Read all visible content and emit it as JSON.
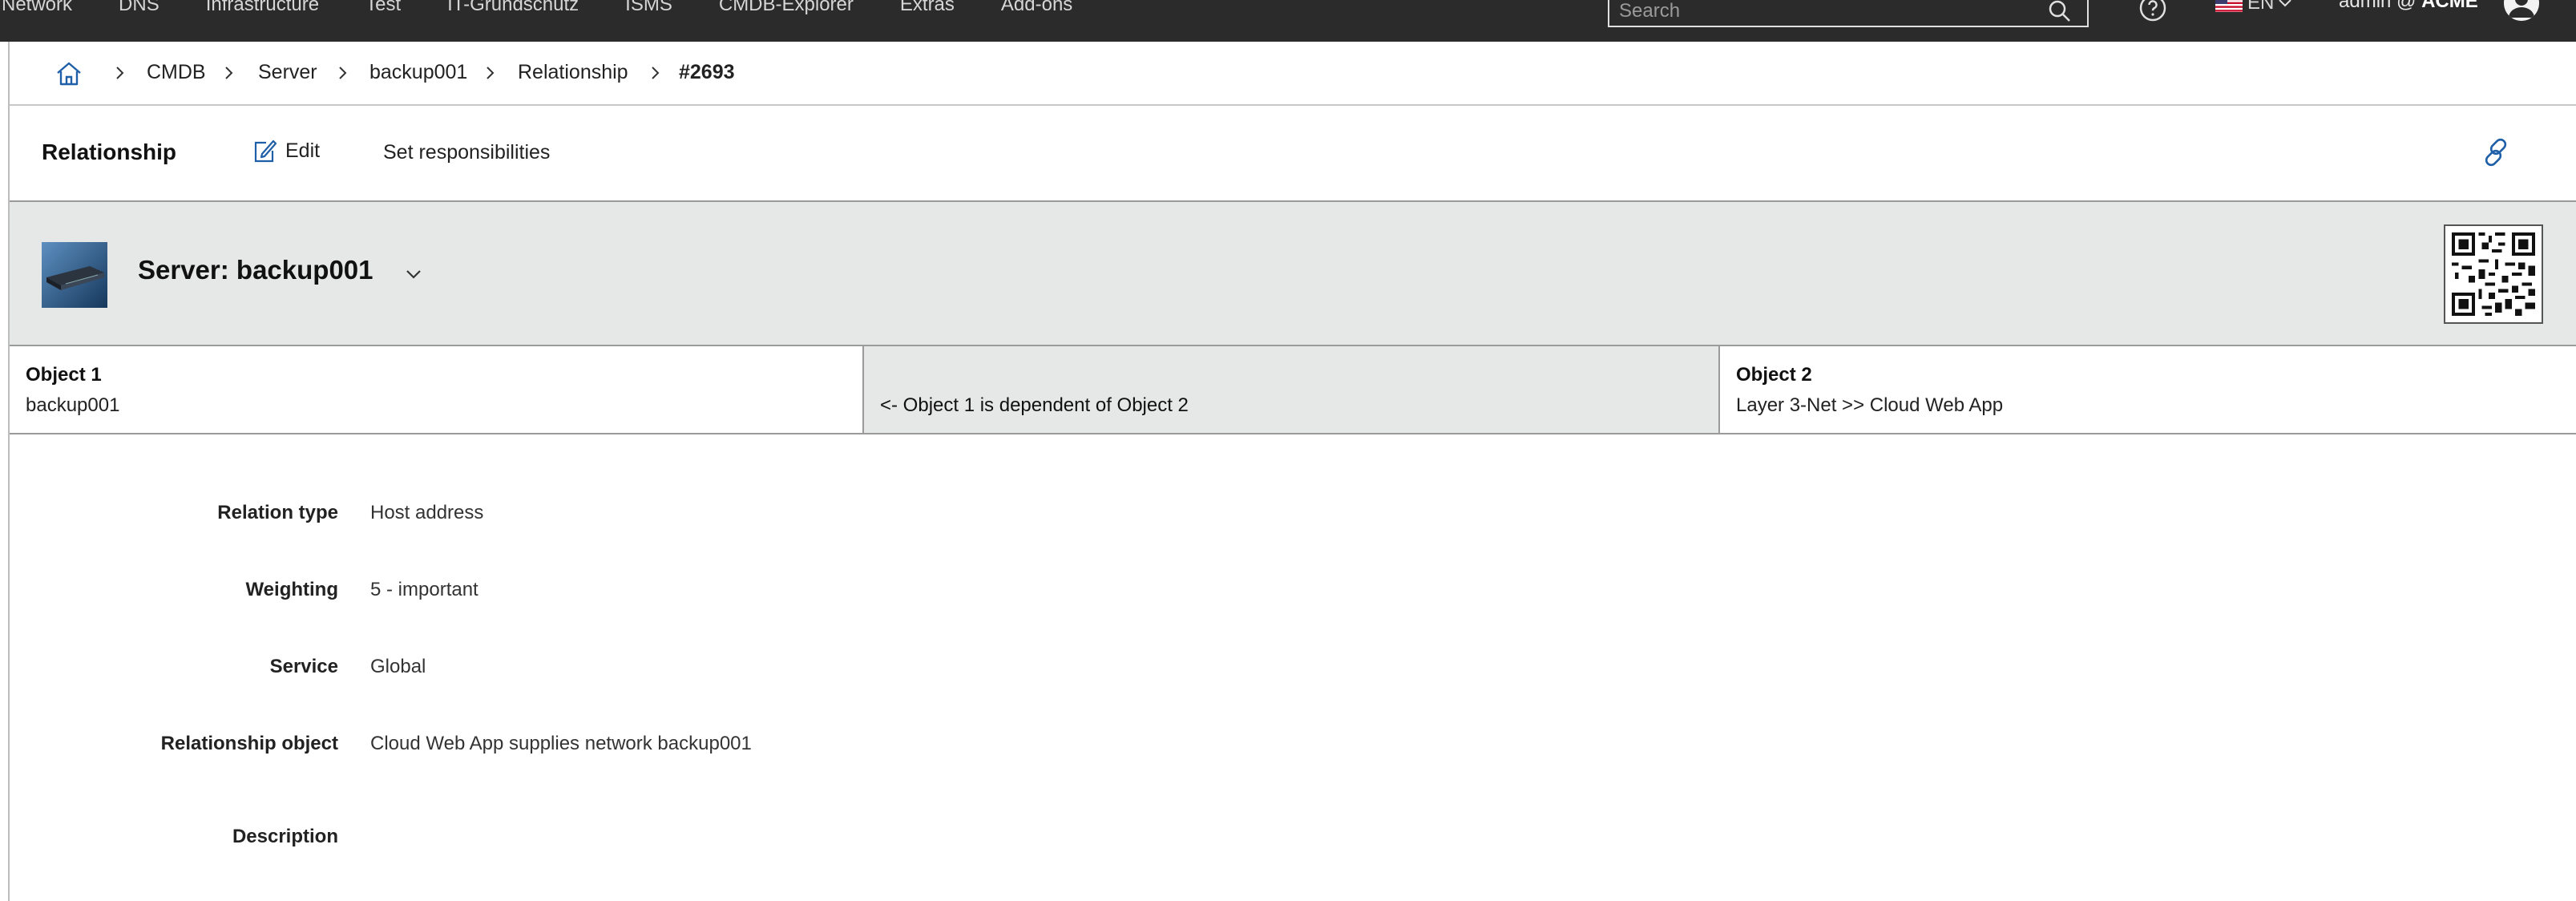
{
  "topnav": {
    "items": [
      "Network",
      "DNS",
      "Infrastructure",
      "Test",
      "IT-Grundschutz",
      "ISMS",
      "CMDB-Explorer",
      "Extras",
      "Add-ons"
    ],
    "search_placeholder": "Search",
    "language": "EN",
    "user_name": "admin @ ",
    "tenant": "ACME"
  },
  "breadcrumb": {
    "items": [
      "CMDB",
      "Server",
      "backup001",
      "Relationship"
    ],
    "current": "#2693"
  },
  "toolbar": {
    "title": "Relationship",
    "edit_label": "Edit",
    "responsibilities_label": "Set responsibilities"
  },
  "object_header": {
    "title": "Server: backup001"
  },
  "objects": {
    "object1_label": "Object 1",
    "object1_value": "backup001",
    "relation_text": "<- Object 1 is dependent of Object 2",
    "object2_label": "Object 2",
    "object2_value": "Layer 3-Net >> Cloud Web App"
  },
  "details": [
    {
      "label": "Relation type",
      "value": "Host address"
    },
    {
      "label": "Weighting",
      "value": "5 - important"
    },
    {
      "label": "Service",
      "value": "Global"
    },
    {
      "label": "Relationship object",
      "value": "Cloud Web App supplies network backup001"
    },
    {
      "label": "Description",
      "value": ""
    }
  ],
  "colors": {
    "topbar": "#2b2b2b",
    "header_gray": "#e6e7e7",
    "link_blue": "#1f5fa8"
  },
  "icons": [
    "home-icon",
    "chevron-right-icon",
    "search-icon",
    "help-icon",
    "flag-us-icon",
    "chevron-down-icon",
    "user-avatar-icon",
    "edit-icon",
    "link-icon",
    "server-thumbnail",
    "qr-code"
  ]
}
